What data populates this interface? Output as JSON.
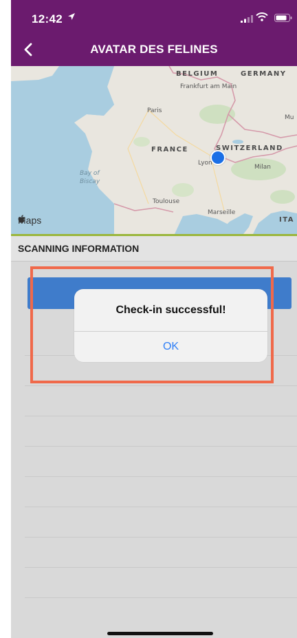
{
  "status_bar": {
    "time": "12:42",
    "icons": [
      "location-arrow-icon",
      "signal-icon",
      "wifi-icon",
      "battery-icon"
    ]
  },
  "nav": {
    "back_icon": "chevron-left-icon",
    "title": "AVATAR DES FELINES"
  },
  "map": {
    "countries": [
      "BELGIUM",
      "GERMANY",
      "FRANCE",
      "SWITZERLAND"
    ],
    "cities": [
      "Frankfurt am Main",
      "Paris",
      "Lyon",
      "Milan",
      "Toulouse",
      "Marseille",
      "Mu"
    ],
    "sea": "Bay of Biscay",
    "attribution": "Maps",
    "partial_labels": [
      "ITA"
    ]
  },
  "section": {
    "title": "SCANNING INFORMATION"
  },
  "dialog": {
    "message": "Check-in successful!",
    "ok_label": "OK"
  },
  "colors": {
    "header_bg": "#6b1b6e",
    "button_blue": "#3f7ccb",
    "highlight": "#f0694a",
    "ios_blue": "#2f7ff6"
  }
}
